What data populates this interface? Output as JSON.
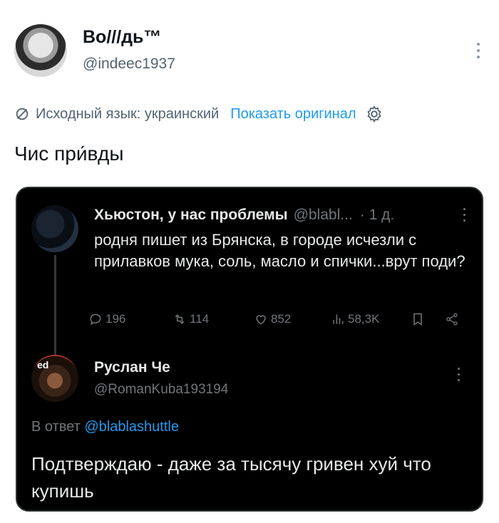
{
  "post": {
    "author_name": "Во///дь™",
    "author_handle": "@indeec1937",
    "translation_note": "Исходный язык: украинский",
    "show_original": "Показать оригинал",
    "text": "Чис при́вды"
  },
  "quoted": {
    "tweet1": {
      "name": "Хьюстон, у нас проблемы",
      "handle": "@blabl...",
      "time": "· 1 д.",
      "text": "родня пишет из Брянска, в городе исчезли с прилавков мука, соль, масло и спички...врут поди?",
      "replies": "196",
      "retweets": "114",
      "likes": "852",
      "views": "58,3K"
    },
    "tweet2": {
      "avatar_tag": "ed",
      "name": "Руслан Че",
      "handle": "@RomanKuba193194",
      "reply_prefix": "В ответ",
      "reply_mention": "@blablashuttle",
      "text": "Подтверждаю - даже за тысячу гривен хуй что купишь"
    }
  },
  "colors": {
    "link": "#1d9bf0",
    "secondary_text": "#536471",
    "card_bg": "#000000"
  },
  "icons": [
    "translate-slash-icon",
    "gear-icon",
    "reply-icon",
    "retweet-icon",
    "like-icon",
    "views-icon",
    "bookmark-icon",
    "share-icon",
    "more-icon"
  ]
}
